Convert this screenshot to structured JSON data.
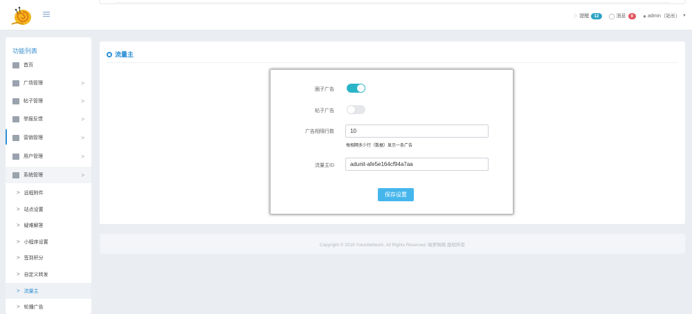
{
  "header": {
    "logo_icon": "snail-logo-icon",
    "menu_icon": "menu-icon",
    "notifications": {
      "icon": "bell-icon",
      "label": "提醒",
      "count": "12",
      "color": "#2aa3c4"
    },
    "messages": {
      "icon": "chat-icon",
      "label": "消息",
      "count": "0",
      "color": "#e0525c"
    },
    "user": {
      "icon": "user-icon",
      "label": "admin（站长）"
    }
  },
  "sidebar": {
    "title": "功能列表",
    "items": [
      {
        "label": "首页",
        "icon": "home-icon",
        "chevron": ""
      },
      {
        "label": "广场管理",
        "icon": "signpost-icon",
        "chevron": ">"
      },
      {
        "label": "帖子管理",
        "icon": "document-icon",
        "chevron": ">"
      },
      {
        "label": "举报反馈",
        "icon": "shield-icon",
        "chevron": ">"
      },
      {
        "label": "营销管理",
        "icon": "magic-wand-icon",
        "chevron": ">"
      },
      {
        "label": "用户管理",
        "icon": "users-icon",
        "chevron": ">"
      },
      {
        "label": "系统管理",
        "icon": "gears-icon",
        "chevron": ">"
      }
    ],
    "sub_items": [
      {
        "label": "远程附件"
      },
      {
        "label": "站点设置"
      },
      {
        "label": "疑难解答"
      },
      {
        "label": "小程序设置"
      },
      {
        "label": "签到积分"
      },
      {
        "label": "自定义转发"
      },
      {
        "label": "流量主"
      },
      {
        "label": "轮播广告"
      }
    ],
    "accent_color": "#2d8fd5"
  },
  "main": {
    "title": "流量主",
    "form": {
      "circle_ad": {
        "label": "圈子广告",
        "enabled": true
      },
      "post_ad": {
        "label": "帖子广告",
        "enabled": false
      },
      "ad_interval": {
        "label": "广告相隔行数",
        "value": "10",
        "hint": "每相隔多少行（数据）显示一条广告"
      },
      "unit_id": {
        "label": "流量主ID",
        "value": "adunit-afe5e164cf94a7aa"
      },
      "save_label": "保存设置"
    },
    "toggle_on_color": "#2ab5c7",
    "button_color": "#45b6ec"
  },
  "footer": {
    "text": "Copyright © 2018 YuluoNetwork. All Rights Reserved. 暗萝网络 版权所有"
  }
}
